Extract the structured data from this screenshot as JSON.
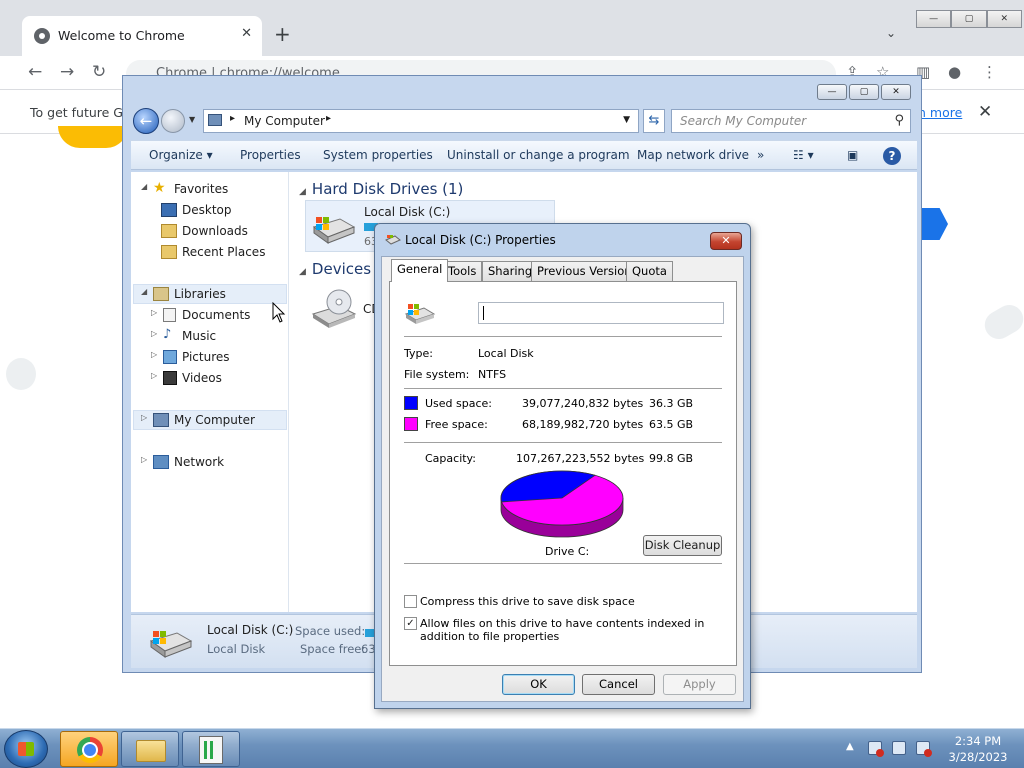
{
  "chrome": {
    "tab_title": "Welcome to Chrome",
    "tab_close": "✕",
    "new_tab": "+",
    "tab_search": "⌄",
    "window_buttons": [
      "—",
      "▢",
      "✕"
    ],
    "omnibox_text": "Chrome  |  chrome://welcome",
    "infobar_text": "To get future Go",
    "infobar_link": "n more",
    "infobar_close": "✕"
  },
  "explorer": {
    "title_buttons": [
      "—",
      "▢",
      "✕"
    ],
    "address": "My Computer",
    "search_placeholder": "Search My Computer",
    "commands": [
      "Organize ▾",
      "Properties",
      "System properties",
      "Uninstall or change a program",
      "Map network drive",
      "»"
    ],
    "nav_tree": {
      "favorites": "Favorites",
      "desktop": "Desktop",
      "downloads": "Downloads",
      "recent_places": "Recent Places",
      "libraries": "Libraries",
      "documents": "Documents",
      "music": "Music",
      "pictures": "Pictures",
      "videos": "Videos",
      "my_computer": "My Computer",
      "network": "Network"
    },
    "hard_disk_header": "Hard Disk Drives (1)",
    "drive_name": "Local Disk (C:)",
    "drive_size_partial": "63",
    "devices_header": "Devices w",
    "cd_label": "CD",
    "details": {
      "name": "Local Disk (C:)",
      "type": "Local Disk",
      "space_used_label": "Space used:",
      "space_free_label": "Space free:",
      "space_free_partial": "63"
    }
  },
  "dialog": {
    "title": "Local Disk (C:) Properties",
    "close": "✕",
    "tabs": [
      "General",
      "Tools",
      "Sharing",
      "Previous Versions",
      "Quota"
    ],
    "name_value": "",
    "type_label": "Type:",
    "type_value": "Local Disk",
    "fs_label": "File system:",
    "fs_value": "NTFS",
    "used_label": "Used space:",
    "used_bytes": "39,077,240,832 bytes",
    "used_gb": "36.3 GB",
    "free_label": "Free space:",
    "free_bytes": "68,189,982,720 bytes",
    "free_gb": "63.5 GB",
    "capacity_label": "Capacity:",
    "capacity_bytes": "107,267,223,552 bytes",
    "capacity_gb": "99.8 GB",
    "used_fraction": 0.364,
    "used_color": "#0000ff",
    "free_color": "#ff00ff",
    "drive_label": "Drive C:",
    "cleanup_button": "Disk Cleanup",
    "compress_label": "Compress this drive to save disk space",
    "compress_checked": false,
    "index_label": "Allow files on this drive to have contents indexed in addition to file properties",
    "index_checked": true,
    "ok": "OK",
    "cancel": "Cancel",
    "apply": "Apply"
  },
  "taskbar": {
    "clock_time": "2:34 PM",
    "clock_date": "3/28/2023",
    "tray_arrow": "▲"
  }
}
